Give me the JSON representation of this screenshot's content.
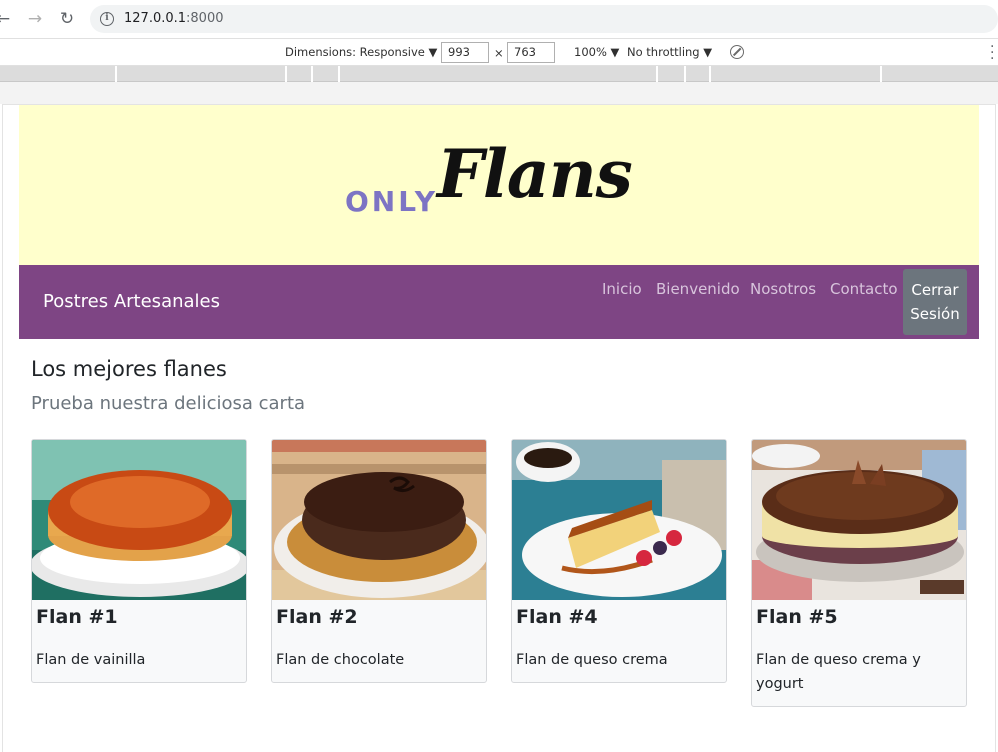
{
  "browser": {
    "url_host": "127.0.0.1",
    "url_port": ":8000"
  },
  "devtools": {
    "dimensions_label": "Dimensions: Responsive ▼",
    "width": "993",
    "times": "×",
    "height": "763",
    "zoom": "100% ▼",
    "throttling": "No throttling ▼"
  },
  "site": {
    "logo_only": "ONLY",
    "logo_flans": "Flans",
    "brand": "Postres Artesanales",
    "nav": [
      "Inicio",
      "Bienvenido",
      "Nosotros",
      "Contacto"
    ],
    "logout_line1": "Cerrar",
    "logout_line2": "Sesión",
    "heading": "Los mejores flanes",
    "subheading": "Prueba nuestra deliciosa carta",
    "cards": [
      {
        "title": "Flan #1",
        "desc": "Flan de vainilla"
      },
      {
        "title": "Flan #2",
        "desc": "Flan de chocolate"
      },
      {
        "title": "Flan #4",
        "desc": "Flan de queso crema"
      },
      {
        "title": "Flan #5",
        "desc": "Flan de queso crema y yogurt"
      }
    ]
  },
  "colors": {
    "banner": "#ffffcc",
    "navbar": "#7e4584",
    "logout": "#6c757d",
    "logo_only": "#7d74c4"
  }
}
